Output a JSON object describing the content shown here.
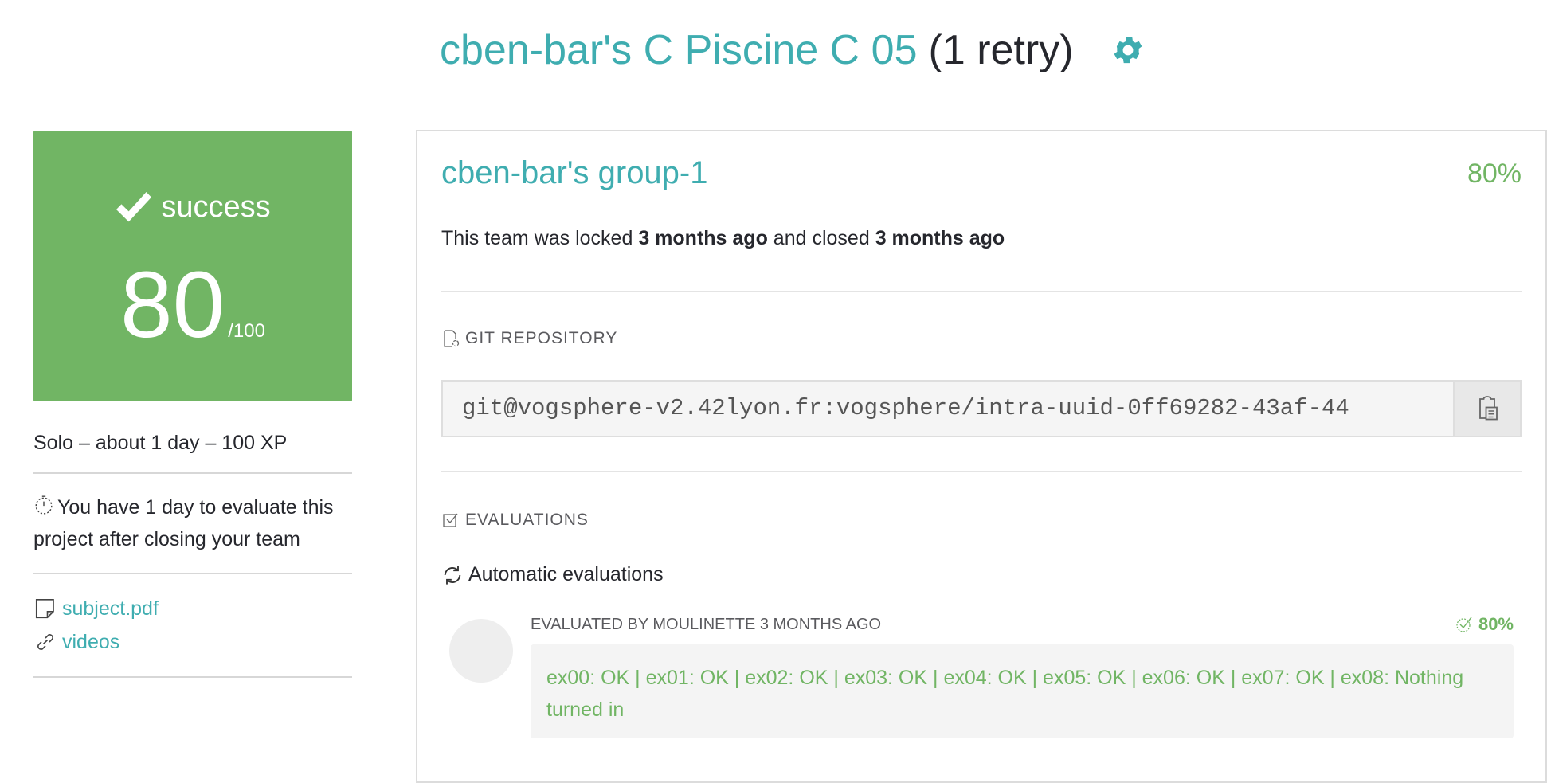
{
  "header": {
    "title": "cben-bar's C Piscine C 05",
    "retry": "(1 retry)",
    "settings_icon": "gear-icon"
  },
  "summary": {
    "status": "success",
    "score": "80",
    "score_max": "/100",
    "meta": "Solo – about 1 day – 100 XP",
    "deadline": "You have 1 day to evaluate this project after closing your team",
    "links": [
      {
        "icon": "file-icon",
        "label": "subject.pdf"
      },
      {
        "icon": "link-icon",
        "label": "videos"
      }
    ],
    "colors": {
      "success": "#71b564",
      "accent": "#3fadb0"
    }
  },
  "team": {
    "name": "cben-bar's group-1",
    "score": "80%",
    "status_prefix": "This team was locked",
    "locked_ago": "3 months ago",
    "status_middle": "and closed",
    "closed_ago": "3 months ago"
  },
  "repository": {
    "label": "GIT REPOSITORY",
    "url": "git@vogsphere-v2.42lyon.fr:vogsphere/intra-uuid-0ff69282-43af-44"
  },
  "evaluations": {
    "label": "EVALUATIONS",
    "automatic_label": "Automatic evaluations",
    "evaluated_by": "EVALUATED BY MOULINETTE 3 MONTHS AGO",
    "score": "80%",
    "result": "ex00: OK | ex01: OK | ex02: OK | ex03: OK | ex04: OK | ex05: OK | ex06: OK | ex07: OK | ex08: Nothing turned in"
  }
}
